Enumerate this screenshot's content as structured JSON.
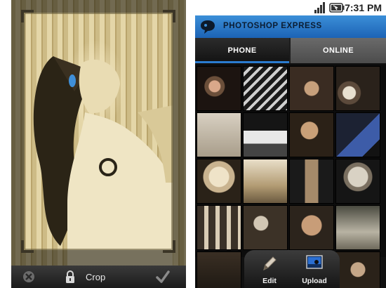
{
  "left_screen": {
    "toolbar": {
      "crop_label": "Crop"
    },
    "icons": {
      "cancel": "cancel-icon",
      "lock": "lock-icon",
      "confirm": "checkmark-icon"
    }
  },
  "right_screen": {
    "status_bar": {
      "time": "7:31 PM",
      "icons": [
        "signal-icon",
        "battery-icon"
      ]
    },
    "header": {
      "title": "PHOTOSHOP EXPRESS"
    },
    "tabs": [
      {
        "label": "PHONE",
        "selected": true
      },
      {
        "label": "ONLINE",
        "selected": false
      }
    ],
    "bottom_actions": [
      {
        "label": "Edit",
        "icon": "pencil-icon"
      },
      {
        "label": "Upload",
        "icon": "upload-icon"
      }
    ]
  },
  "colors": {
    "header_blue": "#2a78c8",
    "tab_underline": "#2b7bd0",
    "sepia": "#d8c89a"
  }
}
